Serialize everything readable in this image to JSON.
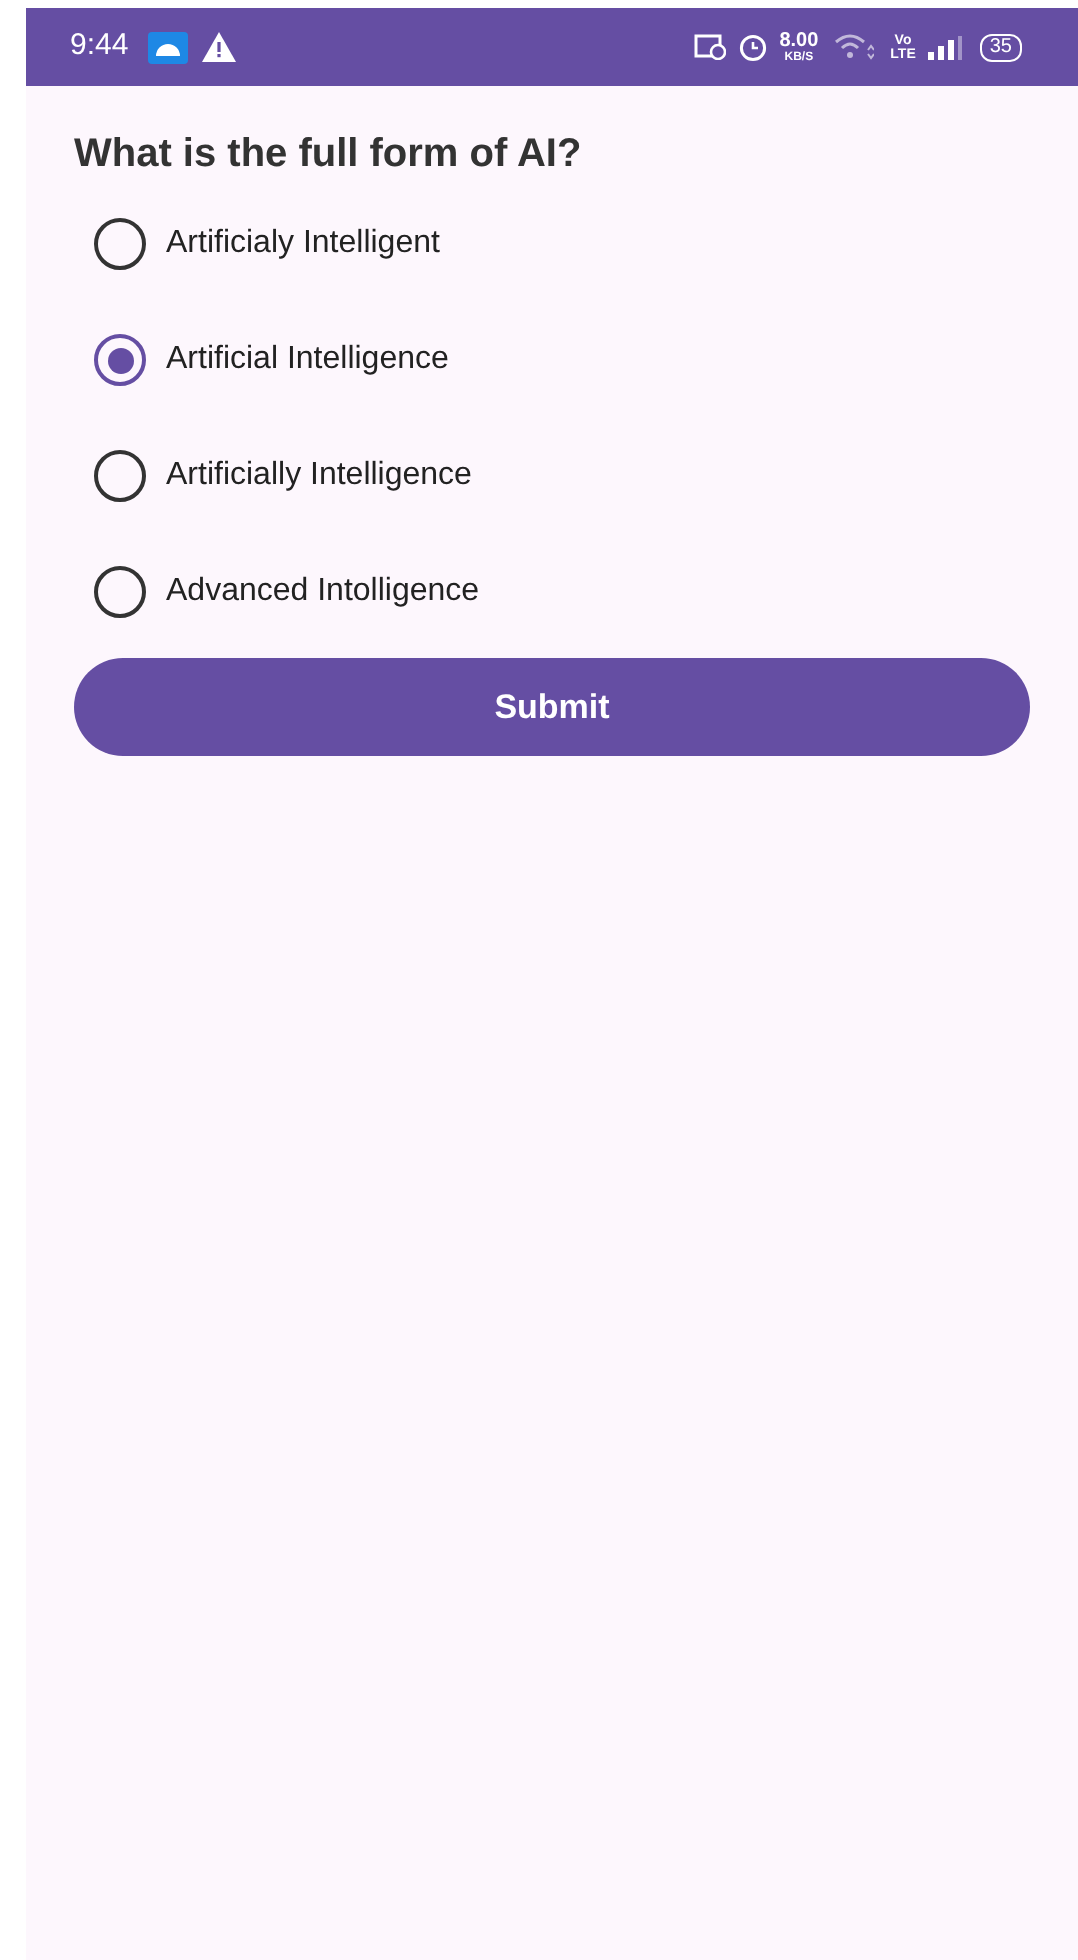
{
  "status_bar": {
    "time": "9:44",
    "speed": "8.00",
    "speed_unit": "KB/S",
    "volte_top": "Vo",
    "volte_bottom": "LTE",
    "battery": "35"
  },
  "question": "What is the full form of AI?",
  "options": [
    {
      "label": "Artificialy Intelligent",
      "selected": false
    },
    {
      "label": "Artificial Intelligence",
      "selected": true
    },
    {
      "label": "Artificially Intelligence",
      "selected": false
    },
    {
      "label": "Advanced Intolligence",
      "selected": false
    }
  ],
  "submit": "Submit"
}
